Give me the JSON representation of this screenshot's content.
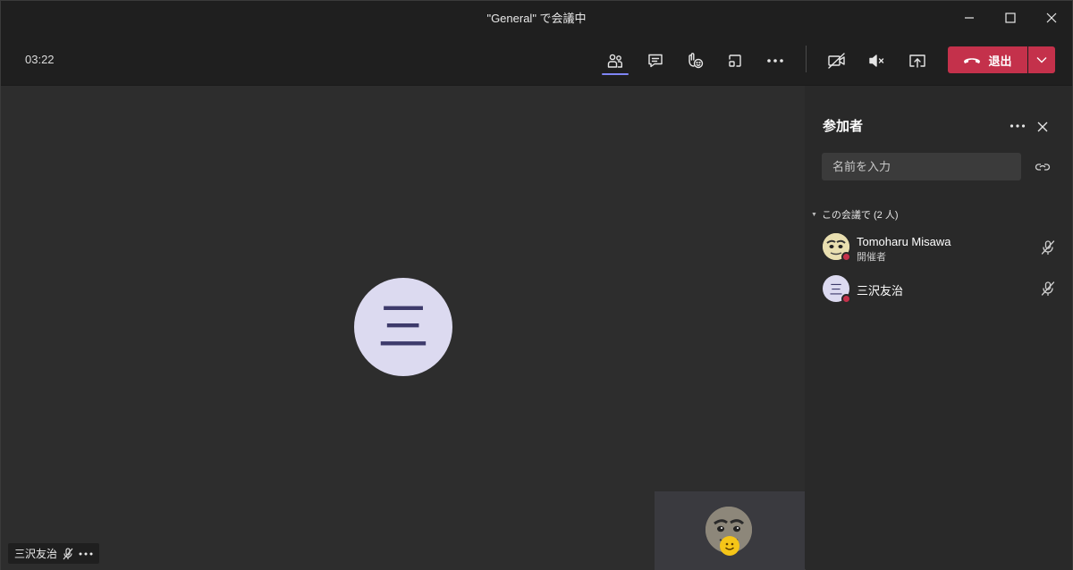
{
  "window": {
    "title": "\"General\" で会議中"
  },
  "toolbar": {
    "timer": "03:22",
    "leave_label": "退出",
    "icons": [
      "participants-icon",
      "chat-icon",
      "raise-hand-icon",
      "breakout-icon",
      "more-icon",
      "camera-off-icon",
      "speaker-muted-icon",
      "share-screen-icon"
    ],
    "accent_color": "#7f85f5",
    "leave_color": "#c4314b"
  },
  "stage": {
    "avatar_initial": "三",
    "name_tag": "三沢友治"
  },
  "panel": {
    "title": "参加者",
    "search_placeholder": "名前を入力",
    "section_label": "この会議で (2 人)",
    "participants": [
      {
        "name": "Tomoharu Misawa",
        "role": "開催者"
      },
      {
        "name": "三沢友治",
        "initial": "三"
      }
    ]
  }
}
